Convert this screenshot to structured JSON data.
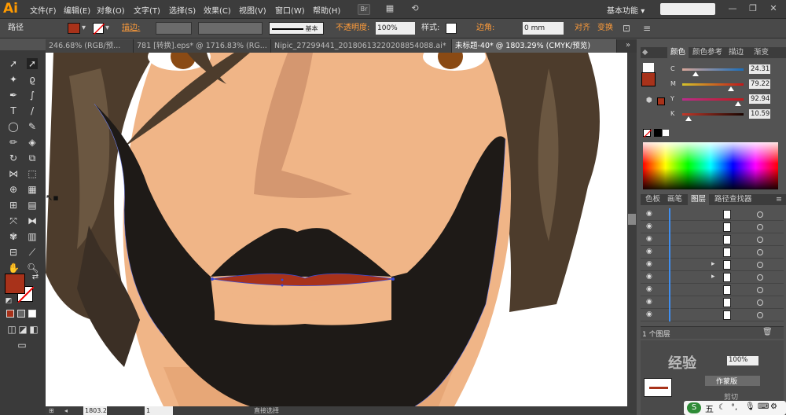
{
  "app": {
    "logo": "Ai"
  },
  "menu": [
    "文件(F)",
    "编辑(E)",
    "对象(O)",
    "文字(T)",
    "选择(S)",
    "效果(C)",
    "视图(V)",
    "窗口(W)",
    "帮助(H)"
  ],
  "menubar_extras": {
    "br": "Br",
    "workspace": "基本功能",
    "workspace_arrow": "▾"
  },
  "control_bar": {
    "label_path": "路径",
    "stroke_label": "描边:",
    "stroke_style": "基本",
    "opacity_label": "不透明度:",
    "opacity_value": "100%",
    "style_label": "样式:",
    "corner_label": "边角:",
    "corner_value": "0 mm",
    "align_label": "对齐",
    "transform_label": "变换"
  },
  "tabs": [
    {
      "label": "246.68% (RGB/预..."
    },
    {
      "label": "781 [转换].eps* @ 1716.83% (RG..."
    },
    {
      "label": "Nipic_27299441_20180613220208854088.ai*"
    },
    {
      "label": "未标题-40* @ 1803.29% (CMYK/预览)"
    }
  ],
  "color_panel": {
    "tabs": [
      "颜色",
      "颜色参考",
      "描边",
      "渐变"
    ],
    "channels": [
      {
        "label": "C",
        "value": "24.31",
        "pct": 24.31,
        "color": "#11c5d6"
      },
      {
        "label": "M",
        "value": "79.22",
        "pct": 79.22,
        "color": "#e4007f"
      },
      {
        "label": "Y",
        "value": "92.94",
        "pct": 92.94,
        "color": "#fff100"
      },
      {
        "label": "K",
        "value": "10.59",
        "pct": 10.59,
        "color": "#111111"
      }
    ],
    "fill_color": "#a8321a"
  },
  "layers_panel": {
    "tabs": [
      "色板",
      "画笔",
      "图层",
      "路径查找器"
    ],
    "footer": "1 个图层",
    "rows": 9
  },
  "bottom_panel": {
    "zoom": "100%",
    "label": "作蒙版",
    "label2": "剪切"
  },
  "status": {
    "zoom": "1803.2",
    "page": "1",
    "tool": "直接选择"
  },
  "watermark": "经验",
  "tray": {
    "ime": "五"
  },
  "colors": {
    "fill": "#a8321a",
    "hair": "#5a4634",
    "beard": "#1e1a17",
    "skin": "#f0b587"
  }
}
